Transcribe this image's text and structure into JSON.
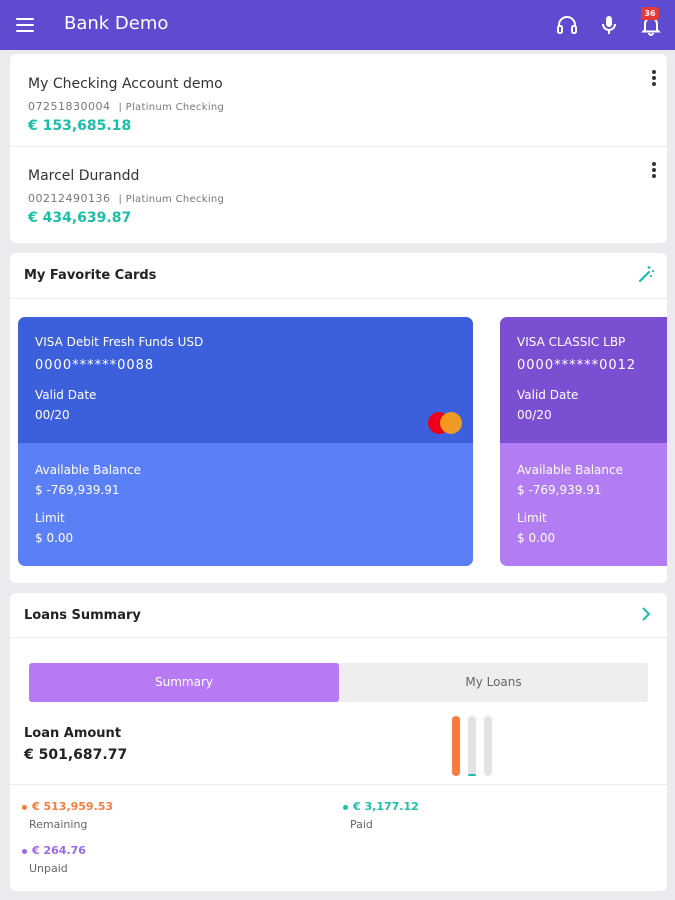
{
  "app": {
    "title": "Bank Demo",
    "notification_count": "36",
    "accent": "#5f4bd0"
  },
  "accounts": [
    {
      "name": "My Checking Account demo",
      "number": "07251830004",
      "type": "| Platinum Checking",
      "balance": "€ 153,685.18"
    },
    {
      "name": "Marcel Durandd",
      "number": "00212490136",
      "type": "| Platinum Checking",
      "balance": "€ 434,639.87"
    }
  ],
  "favorite_cards": {
    "title": "My Favorite Cards",
    "cards": [
      {
        "name": "VISA Debit Fresh Funds USD",
        "number": "0000******0088",
        "valid_label": "Valid Date",
        "valid": "00/20",
        "available_label": "Available Balance",
        "available": "$ -769,939.91",
        "limit_label": "Limit",
        "limit": "$ 0.00",
        "top_color": "#3c5fdc",
        "bottom_color": "#5b80f5"
      },
      {
        "name": "VISA CLASSIC LBP",
        "number": "0000******0012",
        "valid_label": "Valid Date",
        "valid": "00/20",
        "available_label": "Available Balance",
        "available": "$ -769,939.91",
        "limit_label": "Limit",
        "limit": "$ 0.00",
        "top_color": "#7b4fd2",
        "bottom_color": "#b27df3"
      }
    ]
  },
  "loans": {
    "title": "Loans Summary",
    "tabs": {
      "summary": "Summary",
      "my_loans": "My Loans"
    },
    "loan_amount_label": "Loan Amount",
    "loan_amount": "€ 501,687.77",
    "remaining": {
      "amount": "€ 513,959.53",
      "label": "Remaining",
      "color": "#f77c3e"
    },
    "paid": {
      "amount": "€ 3,177.12",
      "label": "Paid",
      "color": "#1bbfa6"
    },
    "unpaid": {
      "amount": "€ 264.76",
      "label": "Unpaid",
      "color": "#9b6ae8"
    }
  }
}
